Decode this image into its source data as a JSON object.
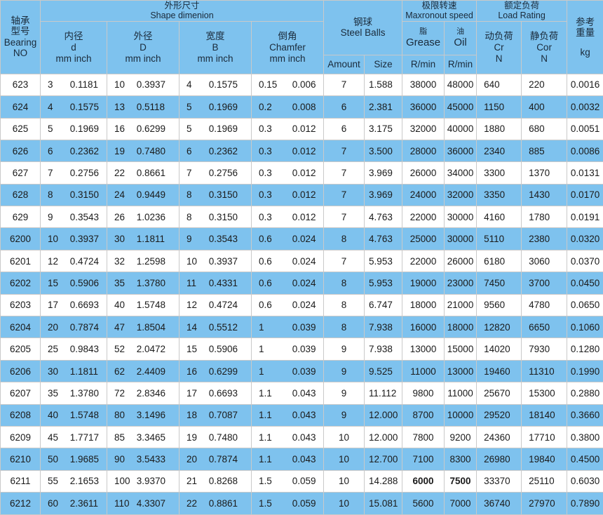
{
  "headers": {
    "model": [
      "轴承",
      "型号",
      "Bearing",
      "NO"
    ],
    "shape": [
      "外形尺寸",
      "Shape dimenion"
    ],
    "bore": [
      "内径",
      "d",
      "mm inch"
    ],
    "outer": [
      "外径",
      "D",
      "mm inch"
    ],
    "width": [
      "宽度",
      "B",
      "mm inch"
    ],
    "chamfer": [
      "倒角",
      "Chamfer",
      "mm inch"
    ],
    "balls": [
      "钢球",
      "Steel Balls"
    ],
    "amount": "Amount",
    "size": "Size",
    "speed": [
      "极限转速",
      "Maxronout speed"
    ],
    "grease": [
      "脂",
      "Grease"
    ],
    "oil": [
      "油",
      "Oil"
    ],
    "rpm1": "R/min",
    "rpm2": "R/min",
    "load": [
      "额定负荷",
      "Load Rating"
    ],
    "dyn": [
      "动负荷",
      "Cr"
    ],
    "stat": [
      "静负荷",
      "Cor"
    ],
    "n1": "N",
    "n2": "N",
    "weight": [
      "参考",
      "重量",
      "kg"
    ]
  },
  "rows": [
    [
      "623",
      "3",
      "0.1181",
      "10",
      "0.3937",
      "4",
      "0.1575",
      "0.15",
      "0.006",
      "7",
      "1.588",
      "38000",
      "48000",
      "640",
      "220",
      "0.0016"
    ],
    [
      "624",
      "4",
      "0.1575",
      "13",
      "0.5118",
      "5",
      "0.1969",
      "0.2",
      "0.008",
      "6",
      "2.381",
      "36000",
      "45000",
      "1150",
      "400",
      "0.0032"
    ],
    [
      "625",
      "5",
      "0.1969",
      "16",
      "0.6299",
      "5",
      "0.1969",
      "0.3",
      "0.012",
      "6",
      "3.175",
      "32000",
      "40000",
      "1880",
      "680",
      "0.0051"
    ],
    [
      "626",
      "6",
      "0.2362",
      "19",
      "0.7480",
      "6",
      "0.2362",
      "0.3",
      "0.012",
      "7",
      "3.500",
      "28000",
      "36000",
      "2340",
      "885",
      "0.0086"
    ],
    [
      "627",
      "7",
      "0.2756",
      "22",
      "0.8661",
      "7",
      "0.2756",
      "0.3",
      "0.012",
      "7",
      "3.969",
      "26000",
      "34000",
      "3300",
      "1370",
      "0.0131"
    ],
    [
      "628",
      "8",
      "0.3150",
      "24",
      "0.9449",
      "8",
      "0.3150",
      "0.3",
      "0.012",
      "7",
      "3.969",
      "24000",
      "32000",
      "3350",
      "1430",
      "0.0170"
    ],
    [
      "629",
      "9",
      "0.3543",
      "26",
      "1.0236",
      "8",
      "0.3150",
      "0.3",
      "0.012",
      "7",
      "4.763",
      "22000",
      "30000",
      "4160",
      "1780",
      "0.0191"
    ],
    [
      "6200",
      "10",
      "0.3937",
      "30",
      "1.1811",
      "9",
      "0.3543",
      "0.6",
      "0.024",
      "8",
      "4.763",
      "25000",
      "30000",
      "5110",
      "2380",
      "0.0320"
    ],
    [
      "6201",
      "12",
      "0.4724",
      "32",
      "1.2598",
      "10",
      "0.3937",
      "0.6",
      "0.024",
      "7",
      "5.953",
      "22000",
      "26000",
      "6180",
      "3060",
      "0.0370"
    ],
    [
      "6202",
      "15",
      "0.5906",
      "35",
      "1.3780",
      "11",
      "0.4331",
      "0.6",
      "0.024",
      "8",
      "5.953",
      "19000",
      "23000",
      "7450",
      "3700",
      "0.0450"
    ],
    [
      "6203",
      "17",
      "0.6693",
      "40",
      "1.5748",
      "12",
      "0.4724",
      "0.6",
      "0.024",
      "8",
      "6.747",
      "18000",
      "21000",
      "9560",
      "4780",
      "0.0650"
    ],
    [
      "6204",
      "20",
      "0.7874",
      "47",
      "1.8504",
      "14",
      "0.5512",
      "1",
      "0.039",
      "8",
      "7.938",
      "16000",
      "18000",
      "12820",
      "6650",
      "0.1060"
    ],
    [
      "6205",
      "25",
      "0.9843",
      "52",
      "2.0472",
      "15",
      "0.5906",
      "1",
      "0.039",
      "9",
      "7.938",
      "13000",
      "15000",
      "14020",
      "7930",
      "0.1280"
    ],
    [
      "6206",
      "30",
      "1.1811",
      "62",
      "2.4409",
      "16",
      "0.6299",
      "1",
      "0.039",
      "9",
      "9.525",
      "11000",
      "13000",
      "19460",
      "11310",
      "0.1990"
    ],
    [
      "6207",
      "35",
      "1.3780",
      "72",
      "2.8346",
      "17",
      "0.6693",
      "1.1",
      "0.043",
      "9",
      "11.112",
      "9800",
      "11000",
      "25670",
      "15300",
      "0.2880"
    ],
    [
      "6208",
      "40",
      "1.5748",
      "80",
      "3.1496",
      "18",
      "0.7087",
      "1.1",
      "0.043",
      "9",
      "12.000",
      "8700",
      "10000",
      "29520",
      "18140",
      "0.3660"
    ],
    [
      "6209",
      "45",
      "1.7717",
      "85",
      "3.3465",
      "19",
      "0.7480",
      "1.1",
      "0.043",
      "10",
      "12.000",
      "7800",
      "9200",
      "24360",
      "17710",
      "0.3800"
    ],
    [
      "6210",
      "50",
      "1.9685",
      "90",
      "3.5433",
      "20",
      "0.7874",
      "1.1",
      "0.043",
      "10",
      "12.700",
      "7100",
      "8300",
      "26980",
      "19840",
      "0.4500"
    ],
    [
      "6211",
      "55",
      "2.1653",
      "100",
      "3.9370",
      "21",
      "0.8268",
      "1.5",
      "0.059",
      "10",
      "14.288",
      "6000",
      "7500",
      "33370",
      "25110",
      "0.6030"
    ],
    [
      "6212",
      "60",
      "2.3611",
      "110",
      "4.3307",
      "22",
      "0.8861",
      "1.5",
      "0.059",
      "10",
      "15.081",
      "5600",
      "7000",
      "36740",
      "27970",
      "0.7890"
    ]
  ]
}
